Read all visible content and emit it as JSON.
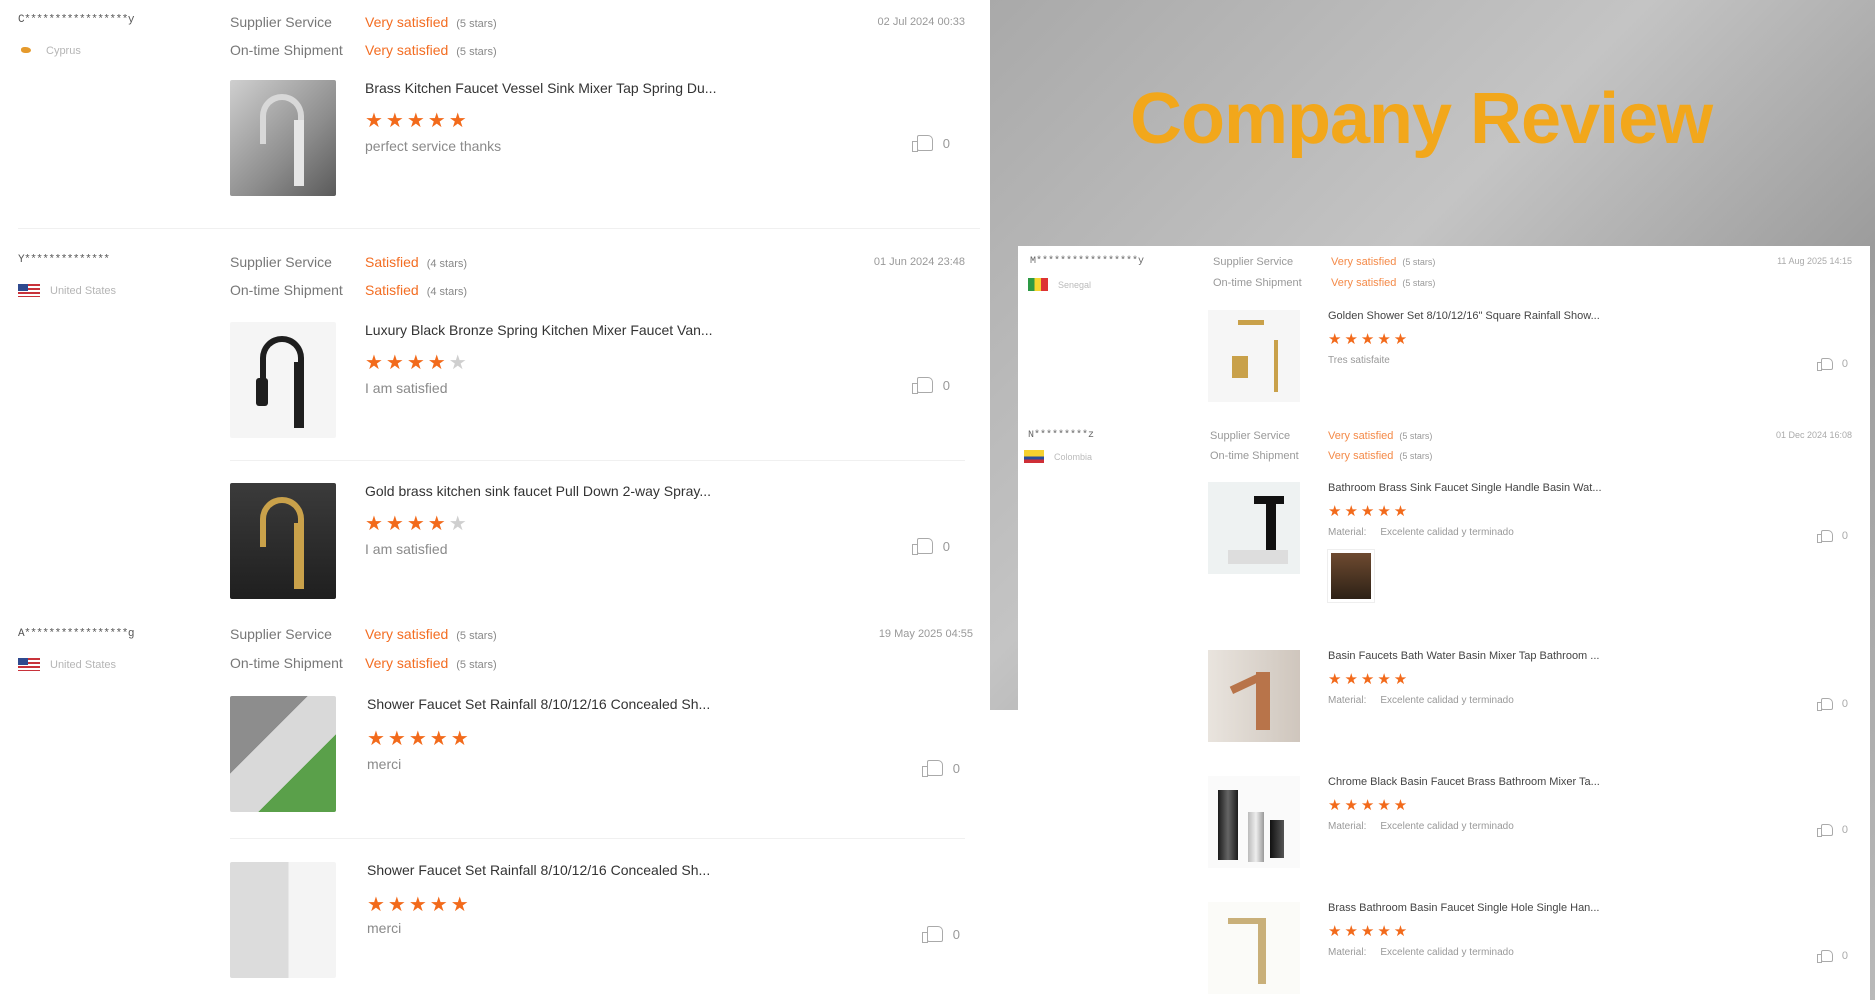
{
  "colors": {
    "accent": "#f36d22",
    "banner_title": "#f2a71b",
    "star": "#f26a1b",
    "star_empty": "#cfcfcf"
  },
  "labels": {
    "supplier_service": "Supplier Service",
    "on_time_shipment": "On-time Shipment",
    "material": "Material:"
  },
  "icons": {
    "like": "thumbs-up-icon",
    "rating": "star-icon"
  },
  "banner": {
    "title": "Company Review"
  },
  "left_reviews": [
    {
      "name": "C*****************y",
      "country": "Cyprus",
      "date": "02 Jul 2024 00:33",
      "supplier_service": {
        "value": "Very satisfied",
        "stars": "(5 stars)"
      },
      "shipment": {
        "value": "Very satisfied",
        "stars": "(5 stars)"
      },
      "products": [
        {
          "title": "Brass Kitchen Faucet Vessel Sink Mixer Tap Spring Du...",
          "rating": 5,
          "comment": "perfect service  thanks",
          "likes": "0"
        }
      ]
    },
    {
      "name": "Y**************",
      "country": "United States",
      "date": "01 Jun 2024 23:48",
      "supplier_service": {
        "value": "Satisfied",
        "stars": "(4 stars)"
      },
      "shipment": {
        "value": "Satisfied",
        "stars": "(4 stars)"
      },
      "products": [
        {
          "title": "Luxury Black Bronze Spring Kitchen Mixer Faucet Van...",
          "rating": 4,
          "comment": "I am satisfied",
          "likes": "0"
        },
        {
          "title": "Gold brass kitchen sink faucet Pull Down 2-way Spray...",
          "rating": 4,
          "comment": "I am satisfied",
          "likes": "0"
        }
      ]
    },
    {
      "name": "A*****************g",
      "country": "United States",
      "date": "19 May 2025 04:55",
      "supplier_service": {
        "value": "Very satisfied",
        "stars": "(5 stars)"
      },
      "shipment": {
        "value": "Very satisfied",
        "stars": "(5 stars)"
      },
      "products": [
        {
          "title": "Shower Faucet Set Rainfall 8/10/12/16 Concealed Sh...",
          "rating": 5,
          "comment": "merci",
          "likes": "0"
        },
        {
          "title": "Shower Faucet Set Rainfall 8/10/12/16 Concealed Sh...",
          "rating": 5,
          "comment": "merci",
          "likes": "0"
        }
      ]
    }
  ],
  "right_reviews": [
    {
      "name": "M*****************y",
      "country": "Senegal",
      "date": "11 Aug 2025 14:15",
      "supplier_service": {
        "value": "Very satisfied",
        "stars": "(5 stars)"
      },
      "shipment": {
        "value": "Very satisfied",
        "stars": "(5 stars)"
      },
      "products": [
        {
          "title": "Golden Shower Set 8/10/12/16\" Square Rainfall Show...",
          "rating": 5,
          "comment": "Tres satisfaite",
          "likes": "0"
        }
      ]
    },
    {
      "name": "N*********z",
      "country": "Colombia",
      "date": "01 Dec 2024 16:08",
      "supplier_service": {
        "value": "Very satisfied",
        "stars": "(5 stars)"
      },
      "shipment": {
        "value": "Very satisfied",
        "stars": "(5 stars)"
      },
      "products": [
        {
          "title": "Bathroom Brass Sink Faucet Single Handle Basin Wat...",
          "rating": 5,
          "comment": "Excelente calidad y terminado",
          "likes": "0"
        },
        {
          "title": "Basin Faucets Bath Water Basin Mixer Tap Bathroom ...",
          "rating": 5,
          "comment": "Excelente calidad y terminado",
          "likes": "0"
        },
        {
          "title": "Chrome Black Basin Faucet Brass Bathroom Mixer Ta...",
          "rating": 5,
          "comment": "Excelente calidad y terminado",
          "likes": "0"
        },
        {
          "title": "Brass Bathroom Basin Faucet Single Hole Single Han...",
          "rating": 5,
          "comment": "Excelente calidad y terminado",
          "likes": "0"
        }
      ]
    }
  ]
}
